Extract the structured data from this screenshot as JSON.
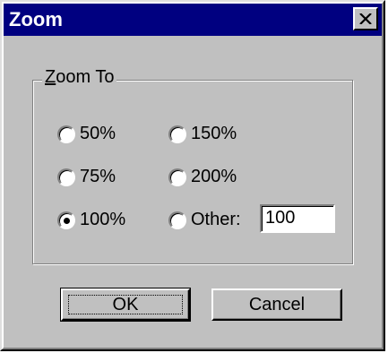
{
  "window": {
    "title": "Zoom",
    "close_icon": "close-x-icon"
  },
  "group": {
    "label": "Zoom To",
    "label_mnemonic": "Z",
    "label_rest": "oom To"
  },
  "options": [
    {
      "label": "50%",
      "selected": false
    },
    {
      "label": "75%",
      "selected": false
    },
    {
      "label": "100%",
      "selected": true
    },
    {
      "label": "150%",
      "selected": false
    },
    {
      "label": "200%",
      "selected": false
    },
    {
      "label": "Other:",
      "selected": false
    }
  ],
  "other_value": "100",
  "buttons": {
    "ok": "OK",
    "cancel": "Cancel"
  }
}
